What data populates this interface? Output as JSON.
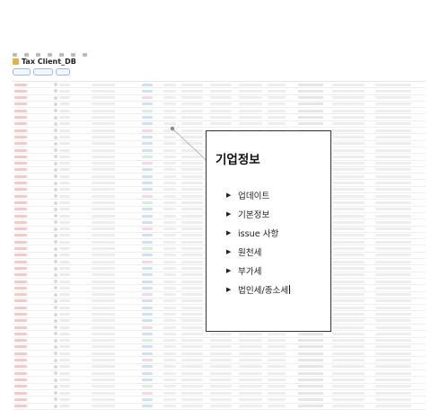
{
  "popup": {
    "title": "기업정보",
    "items": [
      {
        "label": "업데이트"
      },
      {
        "label": "기본정보"
      },
      {
        "label": "issue 사항"
      },
      {
        "label": "원천세"
      },
      {
        "label": "부가세"
      },
      {
        "label": "법인세/종소세"
      }
    ]
  },
  "database": {
    "title": "Tax Client_DB"
  },
  "colors": {
    "popup_border": "#333333",
    "tag_red": "#f6c9c9",
    "pill_blue": "#cfe0f7",
    "filter_blue": "#2a6fd3"
  }
}
